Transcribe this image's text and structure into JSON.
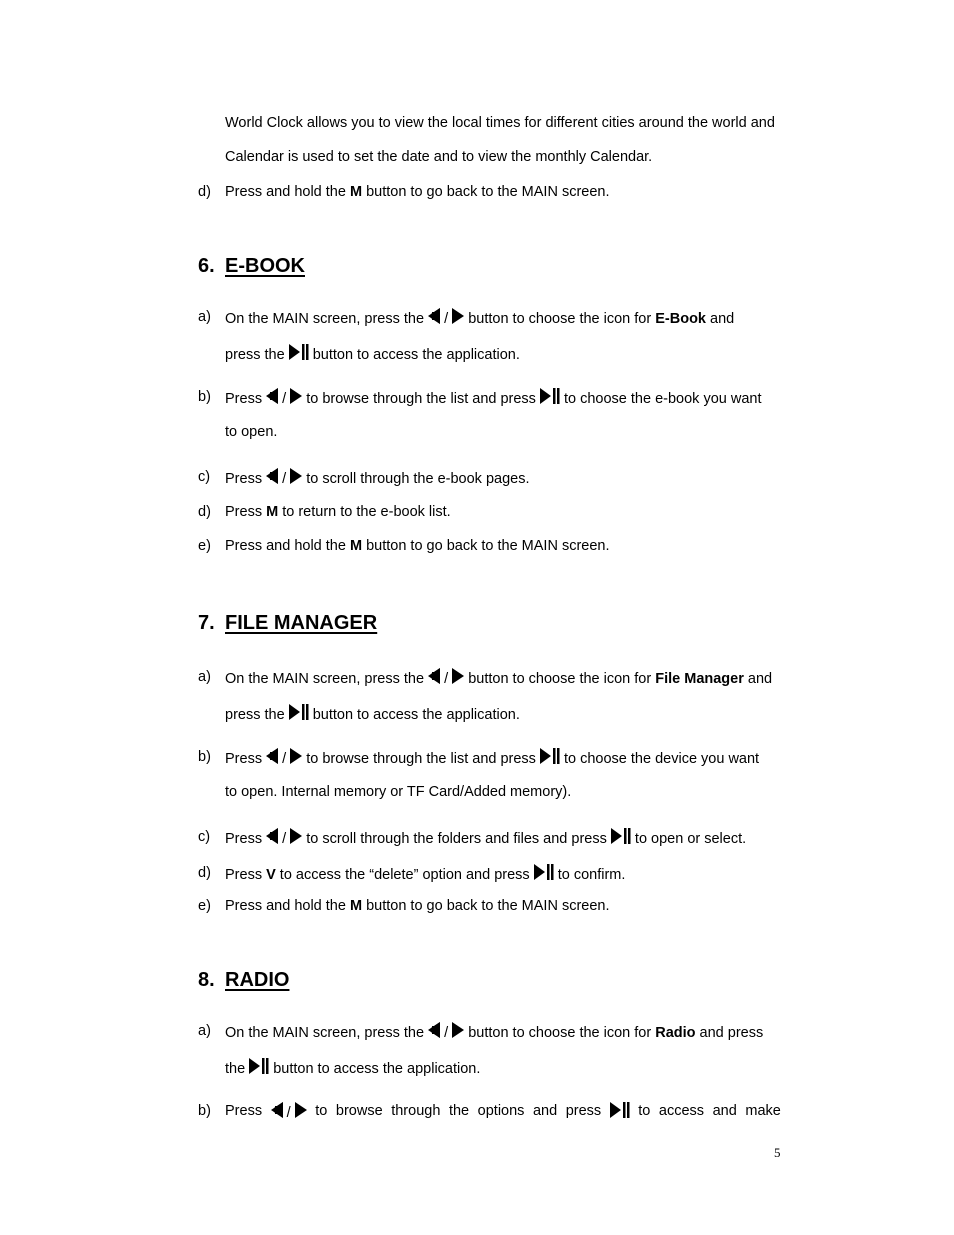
{
  "intro": {
    "line1": "World Clock allows you to view the local times for different cities around the world and",
    "line2": "Calendar is used to set the date and to view the monthly Calendar.",
    "item_d": {
      "label": "d)",
      "pre": "Press and hold the ",
      "bold": "M",
      "post": " button to go back to the MAIN screen."
    }
  },
  "sections": [
    {
      "number": "6.",
      "title": "E-BOOK",
      "items": [
        {
          "label": "a)",
          "p1": "On the MAIN screen, press the ",
          "p2": " button to choose the icon for ",
          "bold": "E-Book",
          "p3": " and",
          "line2_pre": "press the ",
          "line2_post": " button to access the application."
        },
        {
          "label": "b)",
          "p1": "Press ",
          "p2": " to browse through the list and press ",
          "p3": " to choose the e-book you want",
          "line2": "to open."
        },
        {
          "label": "c)",
          "p1": "Press ",
          "p2": " to scroll through the e-book pages."
        },
        {
          "label": "d)",
          "p1": "Press ",
          "bold": "M",
          "p2": " to return to the e-book list."
        },
        {
          "label": "e)",
          "p1": "Press and hold the ",
          "bold": "M",
          "p2": " button to go back to the MAIN screen."
        }
      ]
    },
    {
      "number": "7.",
      "title": "FILE MANAGER",
      "items": [
        {
          "label": "a)",
          "p1": "On the MAIN screen, press the ",
          "p2": " button to choose the icon for ",
          "bold": "File Manager",
          "p3": " and",
          "line2_pre": "press the ",
          "line2_post": " button to access the application."
        },
        {
          "label": "b)",
          "p1": "Press ",
          "p2": " to browse through the list and press ",
          "p3": " to choose the device you want",
          "line2": "to open. Internal memory or TF Card/Added memory)."
        },
        {
          "label": "c)",
          "p1": "Press ",
          "p2": " to scroll through the folders and files and press ",
          "p3": " to open or select."
        },
        {
          "label": "d)",
          "p1": "Press ",
          "bold": "V",
          "p2": " to access the “delete” option and press ",
          "p3": " to confirm."
        },
        {
          "label": "e)",
          "p1": "Press and hold the ",
          "bold": "M",
          "p2": " button to go back to the MAIN screen."
        }
      ]
    },
    {
      "number": "8.",
      "title": "RADIO",
      "items": [
        {
          "label": "a)",
          "p1": "On the MAIN screen, press the ",
          "p2": " button to choose the icon for ",
          "bold": "Radio",
          "p3": " and press",
          "line2_pre": "the ",
          "line2_post": " button to access the application."
        },
        {
          "label": "b)",
          "words": [
            "Press",
            "to",
            "browse",
            "through",
            "the",
            "options",
            "and",
            "press",
            "to",
            "access",
            "and",
            "make"
          ]
        }
      ]
    }
  ],
  "separator": "/",
  "icons": {
    "prev": "prev-triangle-icon",
    "next": "next-triangle-icon",
    "play_pause": "play-pause-icon"
  },
  "page_number": "5"
}
